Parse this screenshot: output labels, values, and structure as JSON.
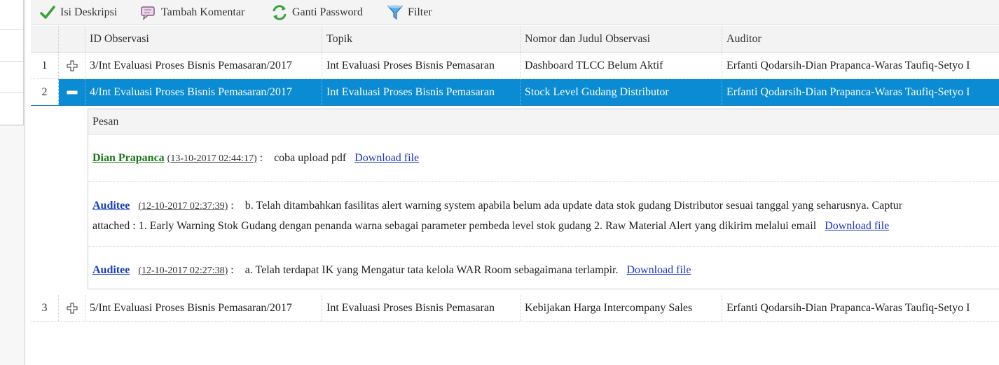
{
  "toolbar": {
    "buttons": [
      {
        "label": "Isi Deskripsi",
        "icon": "checkmark-icon",
        "color": "#3aa13a"
      },
      {
        "label": "Tambah Komentar",
        "icon": "comment-icon",
        "color": "#8a5a8a"
      },
      {
        "label": "Ganti Password",
        "icon": "refresh-icon",
        "color": "#3aa13a"
      },
      {
        "label": "Filter",
        "icon": "funnel-icon",
        "color": "#2a7fd4"
      }
    ]
  },
  "table": {
    "columns": [
      "ID Observasi",
      "Topik",
      "Nomor dan Judul Observasi",
      "Auditor"
    ],
    "rows": [
      {
        "num": "1",
        "id": "3/Int Evaluasi Proses Bisnis Pemasaran/2017",
        "topik": "Int Evaluasi Proses Bisnis Pemasaran",
        "judul": "Dashboard TLCC Belum Aktif",
        "auditor": "Erfanti Qodarsih-Dian Prapanca-Waras Taufiq-Setyo I"
      },
      {
        "num": "2",
        "id": "4/Int Evaluasi Proses Bisnis Pemasaran/2017",
        "topik": "Int Evaluasi Proses Bisnis Pemasaran",
        "judul": "Stock Level Gudang Distributor",
        "auditor": "Erfanti Qodarsih-Dian Prapanca-Waras Taufiq-Setyo I"
      },
      {
        "num": "3",
        "id": "5/Int Evaluasi Proses Bisnis Pemasaran/2017",
        "topik": "Int Evaluasi Proses Bisnis Pemasaran",
        "judul": "Kebijakan Harga Intercompany Sales",
        "auditor": "Erfanti Qodarsih-Dian Prapanca-Waras Taufiq-Setyo I"
      }
    ]
  },
  "detail": {
    "header": "Pesan",
    "messages": [
      {
        "author": "Dian Prapanca",
        "timestamp": "(13-10-2017 02:44:17)",
        "sep": ":",
        "text": "coba upload pdf",
        "text2": "",
        "link": "Download file"
      },
      {
        "author": "Auditee",
        "timestamp": "(12-10-2017 02:37:39)",
        "sep": ":",
        "text": "b. Telah ditambahkan fasilitas alert warning system apabila belum ada update data stok gudang Distributor sesuai tanggal yang seharusnya. Captur",
        "text2": "attached : 1. Early Warning Stok Gudang dengan penanda warna sebagai parameter pembeda level stok gudang 2. Raw Material Alert yang dikirim melalui email",
        "link": "Download file"
      },
      {
        "author": "Auditee",
        "timestamp": "(12-10-2017 02:27:38)",
        "sep": ":",
        "text": "a. Telah terdapat IK yang Mengatur tata kelola WAR Room sebagaimana terlampir.",
        "text2": "",
        "link": "Download file"
      }
    ]
  },
  "colors": {
    "selected_row": "#0a8bd4",
    "link": "#1a35c0",
    "author_green": "#1a7a1a"
  }
}
